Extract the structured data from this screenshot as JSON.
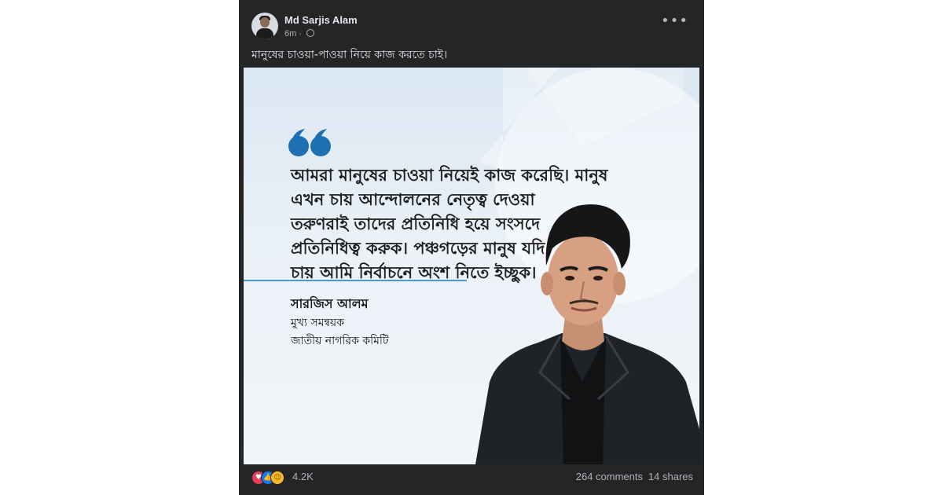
{
  "post": {
    "author": "Md Sarjis Alam",
    "time": "6m",
    "separator": "·",
    "more_label": "•••",
    "caption": "মানুষের চাওয়া-পাওয়া নিয়ে কাজ করতে চাই।"
  },
  "poster": {
    "quote_lines": [
      "আমরা মানুষের চাওয়া নিয়েই কাজ করেছি। মানুষ",
      "এখন চায় আন্দোলনের নেতৃত্ব দেওয়া",
      "তরুণরাই তাদের প্রতিনিধি হয়ে সংসদে",
      "প্রতিনিধিত্ব করুক। পঞ্চগড়ের মানুষ যদি",
      "চায় আমি নির্বাচনে অংশ নিতে ইচ্ছুক।"
    ],
    "name": "সারজিস আলম",
    "role1": "মুখ্য সমন্বয়ক",
    "role2": "জাতীয় নাগরিক কমিটি",
    "accent_color": "#1e6fb3"
  },
  "footer": {
    "reaction_icons": [
      "love-reaction-icon",
      "like-reaction-icon",
      "care-reaction-icon"
    ],
    "reactions_count": "4.2K",
    "comments": "264 comments",
    "shares": "14 shares"
  },
  "colors": {
    "post_background": "#242526",
    "text_primary": "#e4e6eb",
    "text_secondary": "#b0b3b8"
  }
}
